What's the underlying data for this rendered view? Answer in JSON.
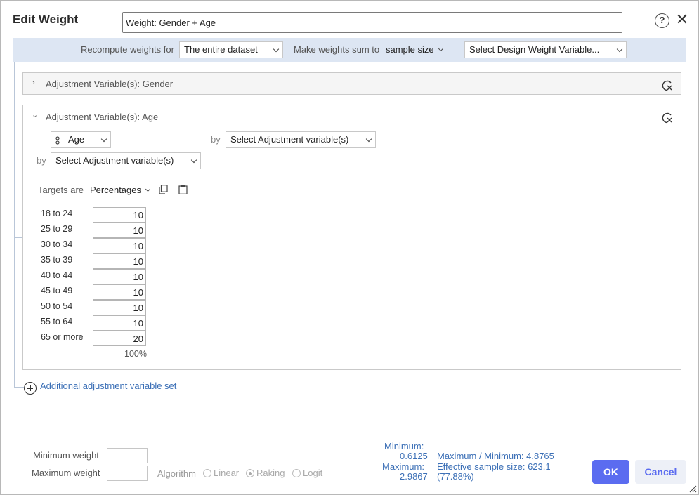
{
  "dialog": {
    "title": "Edit Weight",
    "weight_name": "Weight: Gender + Age",
    "help_icon": "question-circle-icon",
    "close_icon": "close-x-icon"
  },
  "recompute": {
    "label": "Recompute weights for",
    "scope_value": "The entire dataset",
    "sum_label": "Make weights sum to",
    "sum_value": "sample size",
    "design_weight_placeholder": "Select Design Weight Variable..."
  },
  "sets": [
    {
      "header": "Adjustment Variable(s): Gender",
      "expanded": false
    },
    {
      "header": "Adjustment Variable(s): Age",
      "expanded": true,
      "variable": "Age",
      "by_label": "by",
      "select_placeholder": "Select Adjustment variable(s)",
      "targets_label": "Targets are",
      "targets_mode": "Percentages",
      "rows": [
        {
          "label": "18 to 24",
          "value": "10"
        },
        {
          "label": "25 to 29",
          "value": "10"
        },
        {
          "label": "30 to 34",
          "value": "10"
        },
        {
          "label": "35 to 39",
          "value": "10"
        },
        {
          "label": "40 to 44",
          "value": "10"
        },
        {
          "label": "45 to 49",
          "value": "10"
        },
        {
          "label": "50 to 54",
          "value": "10"
        },
        {
          "label": "55 to 64",
          "value": "10"
        },
        {
          "label": "65 or more",
          "value": "20"
        }
      ],
      "total": "100%"
    }
  ],
  "add_set_label": "Additional adjustment variable set",
  "footer": {
    "min_weight_label": "Minimum weight",
    "max_weight_label": "Maximum weight",
    "algorithm_label": "Algorithm",
    "algorithms": [
      "Linear",
      "Raking",
      "Logit"
    ],
    "selected_algorithm": "Raking",
    "stats": {
      "minimum_label": "Minimum:",
      "minimum_value": "0.6125",
      "maximum_label": "Maximum:",
      "maximum_value": "2.9867",
      "ratio": "Maximum / Minimum: 4.8765",
      "ess": "Effective sample size: 623.1",
      "ess_pct": "(77.88%)"
    },
    "ok_label": "OK",
    "cancel_label": "Cancel"
  },
  "colors": {
    "accent": "#5b6cf0",
    "link": "#3b6fb6",
    "bar_bg": "#dde6f3"
  }
}
